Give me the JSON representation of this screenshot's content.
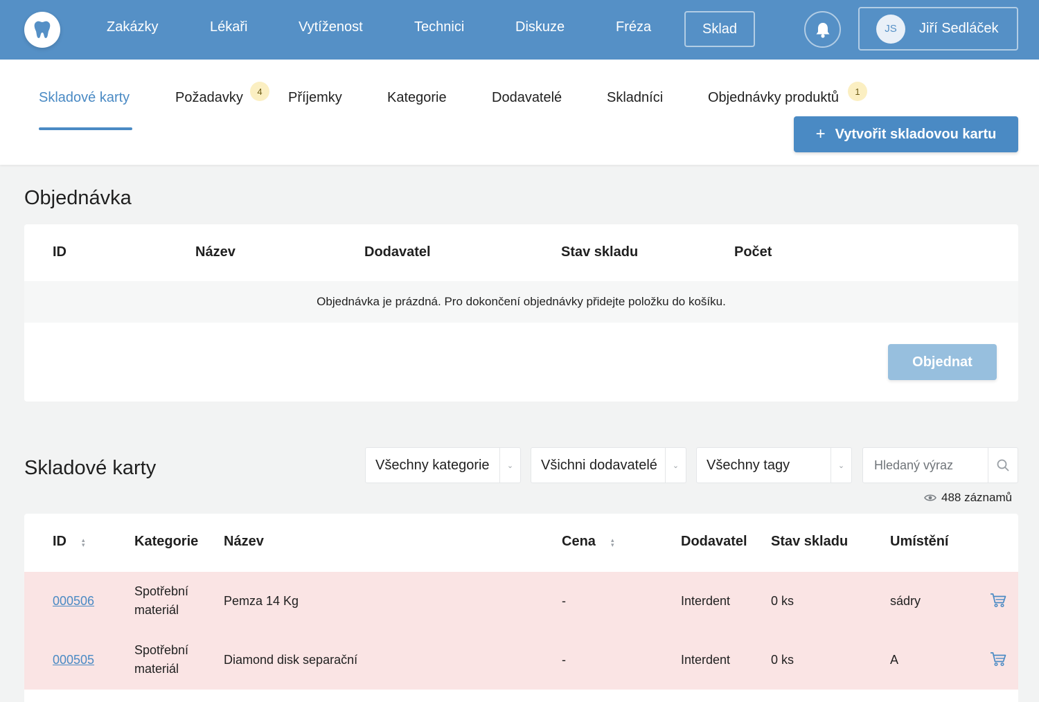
{
  "nav": {
    "items": [
      "Zakázky",
      "Lékaři",
      "Vytíženost",
      "Technici",
      "Diskuze",
      "Fréza"
    ],
    "active": "Sklad",
    "user_initials": "JS",
    "user_name": "Jiří Sedláček"
  },
  "subnav": {
    "tabs": [
      "Skladové karty",
      "Požadavky",
      "Příjemky",
      "Kategorie",
      "Dodavatelé",
      "Skladníci",
      "Objednávky produktů"
    ],
    "badges": {
      "pozadavky": "4",
      "objednavky": "1"
    },
    "create_button": "Vytvořit skladovou kartu"
  },
  "order": {
    "title": "Objednávka",
    "headers": [
      "ID",
      "Název",
      "Dodavatel",
      "Stav skladu",
      "Počet"
    ],
    "empty_message": "Objednávka je prázdná. Pro dokončení objednávky přidejte položku do košíku.",
    "submit_label": "Objednat"
  },
  "stock": {
    "title": "Skladové karty",
    "filters": {
      "category": "Všechny kategorie",
      "supplier": "Všichni dodavatelé",
      "tags": "Všechny tagy",
      "search_placeholder": "Hledaný výraz"
    },
    "records": "488 záznamů",
    "headers": [
      "ID",
      "Kategorie",
      "Název",
      "Cena",
      "Dodavatel",
      "Stav skladu",
      "Umístění"
    ],
    "rows": [
      {
        "id": "000506",
        "category_l1": "Spotřební",
        "category_l2": "materiál",
        "name": "Pemza 14 Kg",
        "price": "-",
        "supplier": "Interdent",
        "stock": "0 ks",
        "location": "sádry"
      },
      {
        "id": "000505",
        "category_l1": "Spotřební",
        "category_l2": "materiál",
        "name": "Diamond disk separační",
        "price": "-",
        "supplier": "Interdent",
        "stock": "0 ks",
        "location": "A"
      }
    ]
  },
  "colors": {
    "primary": "#5590c6",
    "accent": "#4a8ac4",
    "row_alert": "#fae4e4",
    "badge": "#fbefc2"
  }
}
